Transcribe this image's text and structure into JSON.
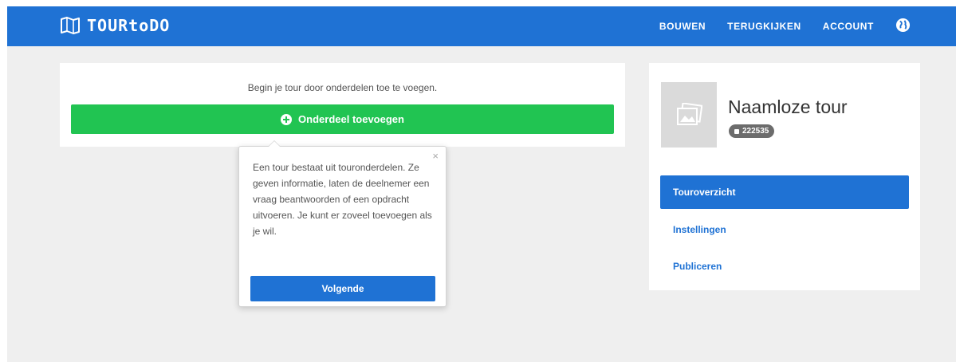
{
  "app": {
    "name": "TOURtoDO"
  },
  "nav": {
    "links": [
      "BOUWEN",
      "TERUGKIJKEN",
      "ACCOUNT"
    ],
    "language_icon": "globe-icon"
  },
  "builder": {
    "hint": "Begin je tour door onderdelen toe te voegen.",
    "add_button": "Onderdeel toevoegen",
    "add_icon": "plus-circle-icon"
  },
  "tooltip": {
    "text": "Een tour bestaat uit touronderdelen. Ze geven informatie, laten de deelnemer een vraag beantwoorden of een opdracht uitvoeren. Je kunt er zoveel toevoegen als je wil.",
    "close": "×",
    "next_button": "Volgende"
  },
  "tour": {
    "title": "Naamloze tour",
    "id_badge": "222535",
    "thumbnail_icon": "image-placeholder-icon"
  },
  "side_menu": {
    "items": [
      "Touroverzicht",
      "Instellingen",
      "Publiceren"
    ],
    "active_index": 0
  },
  "colors": {
    "brand_blue": "#1f72d4",
    "success_green": "#21c452",
    "background": "#efefef",
    "badge_gray": "#6c6c6c"
  }
}
